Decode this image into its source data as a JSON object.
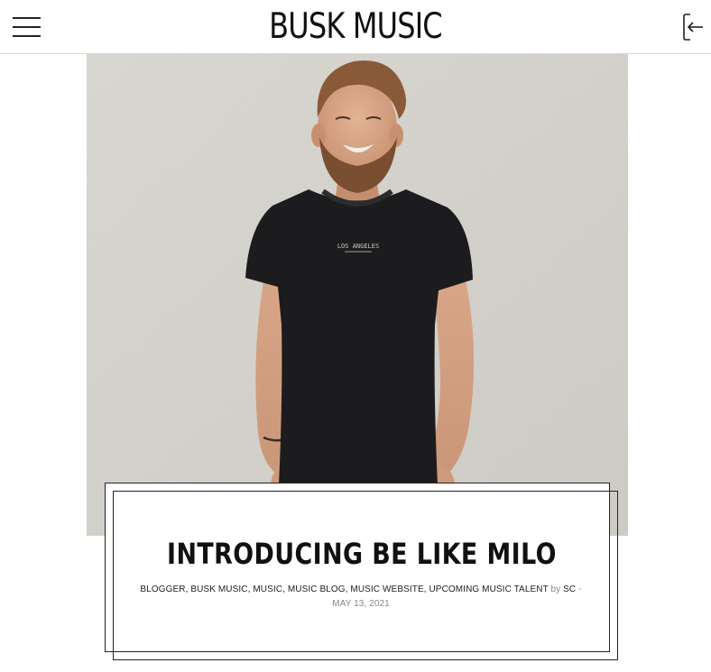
{
  "header": {
    "site_title": "BUSK MUSIC",
    "menu_icon": "hamburger-menu-icon",
    "login_icon": "login-arrow-icon"
  },
  "post": {
    "title": "INTRODUCING BE LIKE MILO",
    "categories": [
      "BLOGGER",
      "BUSK MUSIC",
      "MUSIC",
      "MUSIC BLOG",
      "MUSIC WEBSITE",
      "UPCOMING MUSIC TALENT"
    ],
    "by_label": "by",
    "author": "SC",
    "separator": "-",
    "date": "MAY 13, 2021",
    "shirt_text": "LOS ANGELES"
  },
  "colors": {
    "text": "#111111",
    "muted": "#888888",
    "wall": "#d8d6d0",
    "shirt": "#1c1c1e"
  }
}
